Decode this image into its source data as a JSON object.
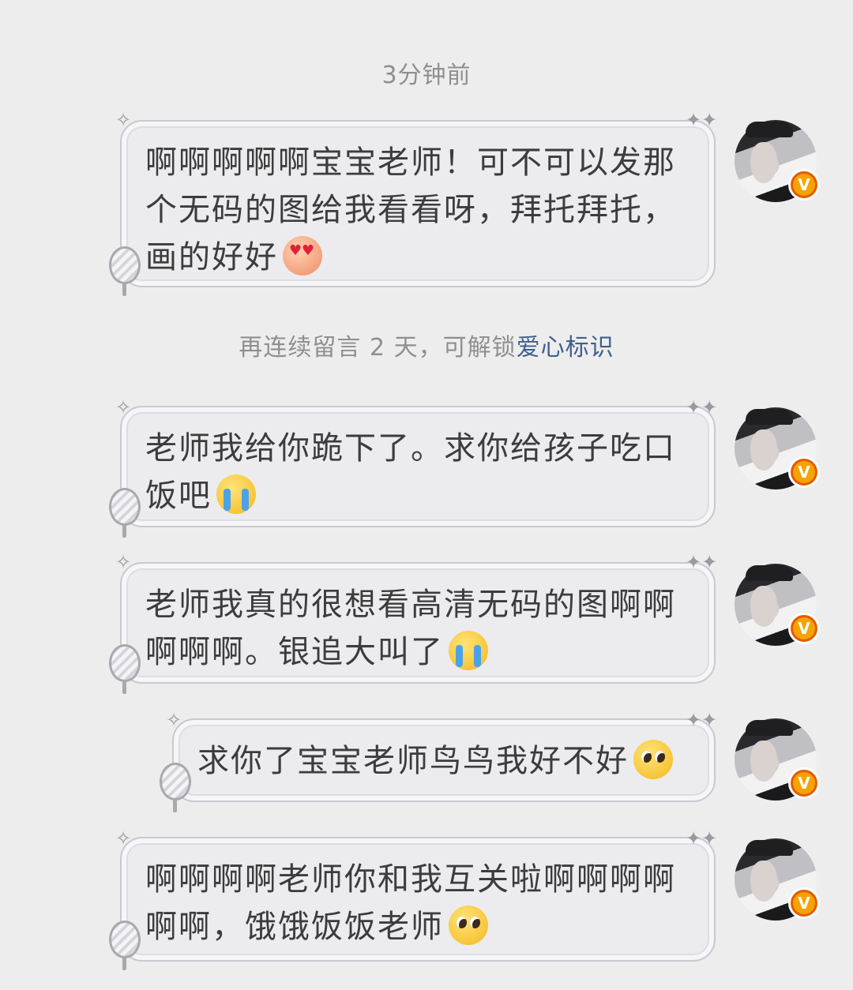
{
  "timestamp": "3分钟前",
  "unlock_hint": {
    "prefix": "再连续留言 2 天，可解锁",
    "highlight": "爱心标识"
  },
  "messages": [
    {
      "text": "啊啊啊啊啊宝宝老师！可不可以发那个无码的图给我看看呀，拜托拜托，画的好好",
      "emoji": "smiling-face-with-heart-eyes"
    },
    {
      "text": "老师我给你跪下了。求你给孩子吃口饭吧",
      "emoji": "loudly-crying-face"
    },
    {
      "text": "老师我真的很想看高清无码的图啊啊啊啊啊。银追大叫了",
      "emoji": "loudly-crying-face"
    },
    {
      "text": "求你了宝宝老师鸟鸟我好不好",
      "emoji": "pleading-face"
    },
    {
      "text": "啊啊啊啊老师你和我互关啦啊啊啊啊啊啊，饿饿饭饭老师",
      "emoji": "pleading-face"
    }
  ],
  "avatar": {
    "badge_label": "V",
    "badge_color": "#f5a300"
  },
  "colors": {
    "background": "#ededed",
    "bubble": "#ececef",
    "highlight": "#3f5f8f",
    "meta_text": "#8f8f8f"
  }
}
